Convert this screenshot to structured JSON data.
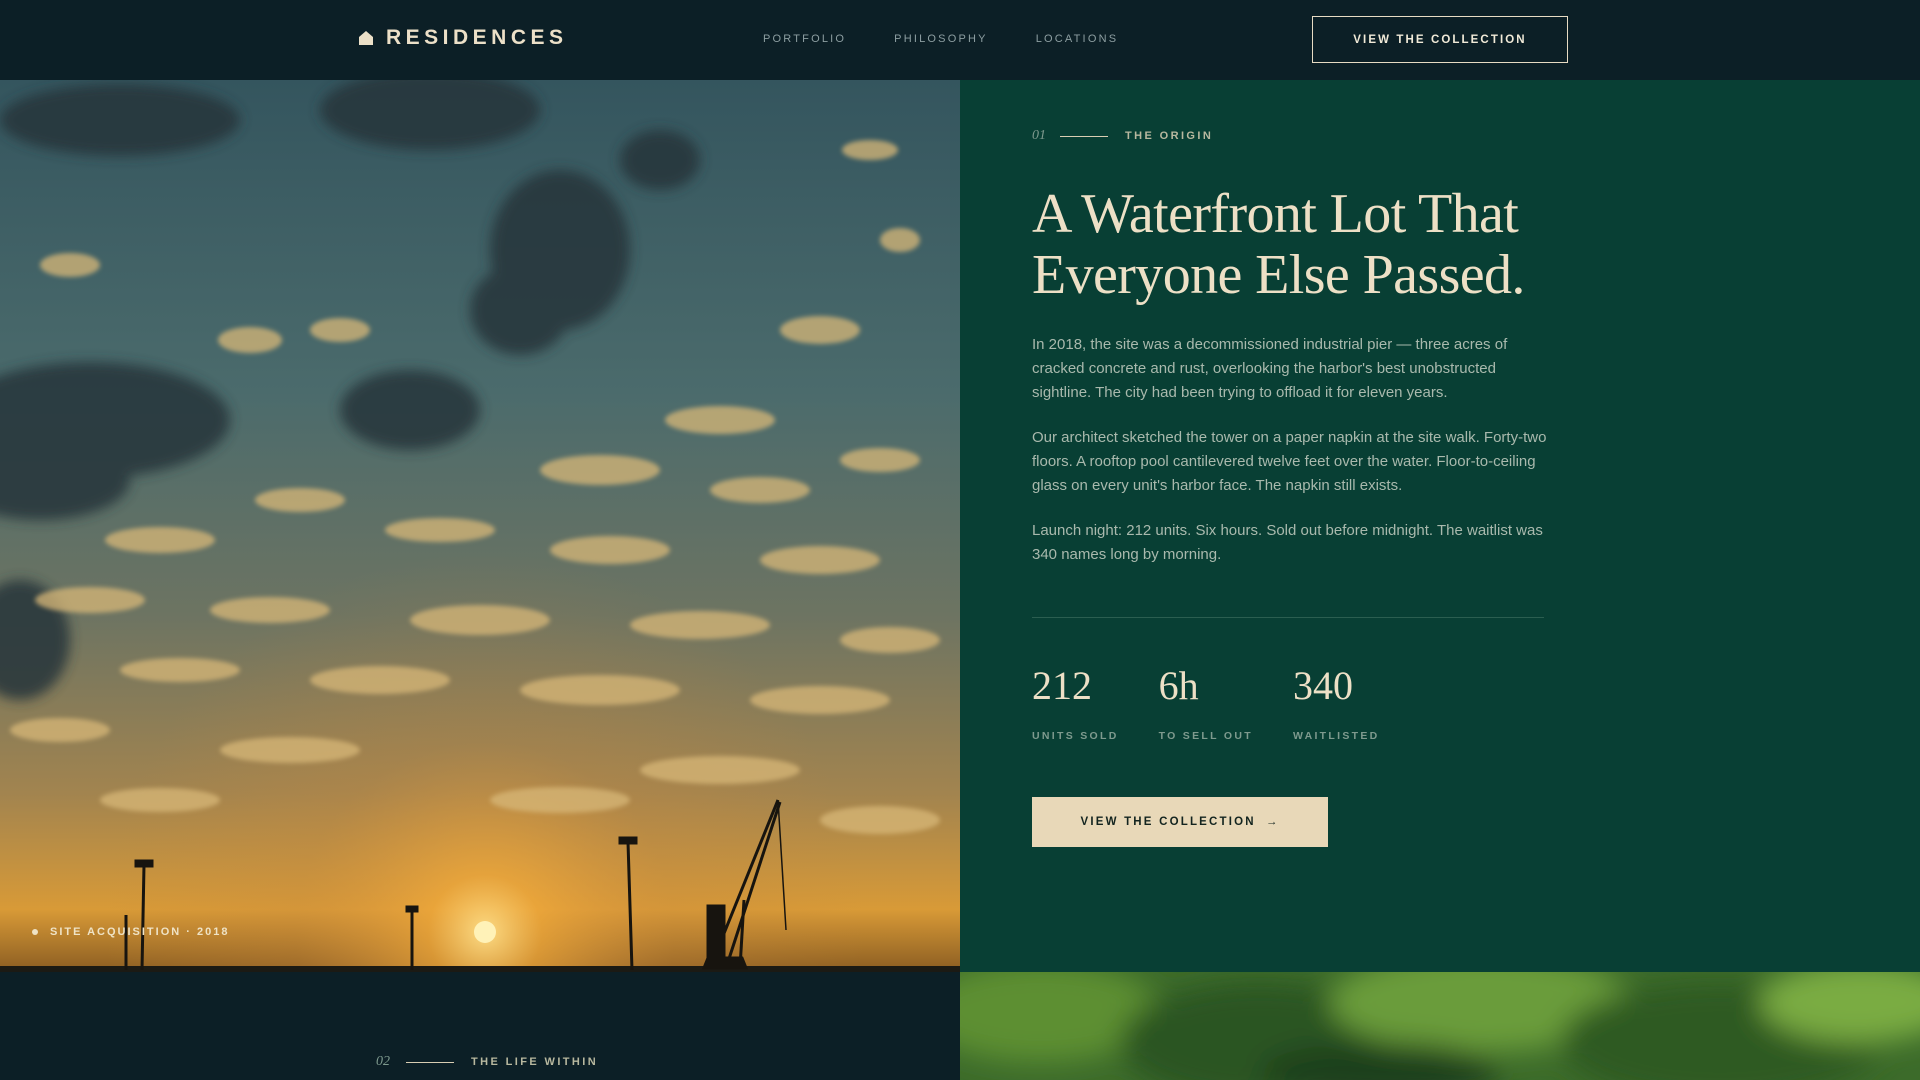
{
  "nav": {
    "brand": "RESIDENCES",
    "brand_icon": "house-icon",
    "links": [
      "PORTFOLIO",
      "PHILOSOPHY",
      "LOCATIONS"
    ],
    "cta_label": "VIEW THE COLLECTION"
  },
  "hero": {
    "image": "sunset-harbor-crane-photo",
    "caption": "SITE ACQUISITION · 2018"
  },
  "story": {
    "number": "01",
    "label": "THE ORIGIN",
    "headline": "A Waterfront Lot That Everyone Else Passed.",
    "paragraphs": [
      "In 2018, the site was a decommissioned industrial pier — three acres of cracked concrete and rust, overlooking the harbor's best unobstructed sightline. The city had been trying to offload it for eleven years.",
      "Our architect sketched the tower on a paper napkin at the site walk. Forty-two floors. A rooftop pool cantilevered twelve feet over the water. Floor-to-ceiling glass on every unit's harbor face. The napkin still exists.",
      "Launch night: 212 units. Six hours. Sold out before midnight. The waitlist was 340 names long by morning."
    ],
    "stats": [
      {
        "value": "212",
        "label": "UNITS SOLD"
      },
      {
        "value": "6h",
        "label": "TO SELL OUT"
      },
      {
        "value": "340",
        "label": "WAITLISTED"
      }
    ],
    "cta_label": "VIEW THE COLLECTION",
    "cta_arrow": "→"
  },
  "next_section": {
    "number": "02",
    "label": "THE LIFE WITHIN",
    "image": "green-foliage-photo"
  },
  "colors": {
    "navy": "#0c1f26",
    "forest": "#083f34",
    "cream": "#ede0c6",
    "button_cream": "#e8d8b8"
  }
}
